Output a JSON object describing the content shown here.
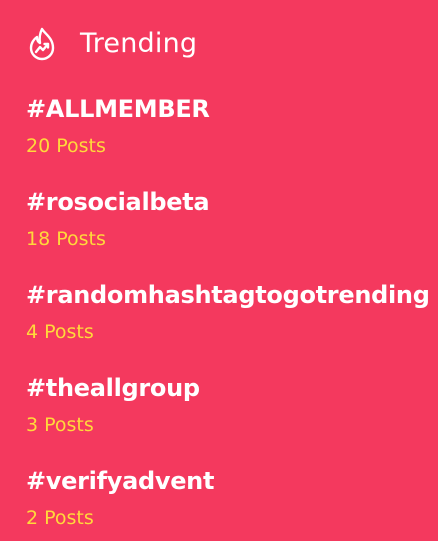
{
  "header": {
    "icon": "flame-trending-icon",
    "title": "Trending"
  },
  "trending": [
    {
      "tag": "#ALLMEMBER",
      "count": "20 Posts"
    },
    {
      "tag": "#rosocialbeta",
      "count": "18 Posts"
    },
    {
      "tag": "#randomhashtagtogotrending",
      "count": "4 Posts"
    },
    {
      "tag": "#theallgroup",
      "count": "3 Posts"
    },
    {
      "tag": "#verifyadvent",
      "count": "2 Posts"
    }
  ],
  "colors": {
    "background": "#f4395e",
    "text": "#ffffff",
    "count": "#ffd93b"
  }
}
